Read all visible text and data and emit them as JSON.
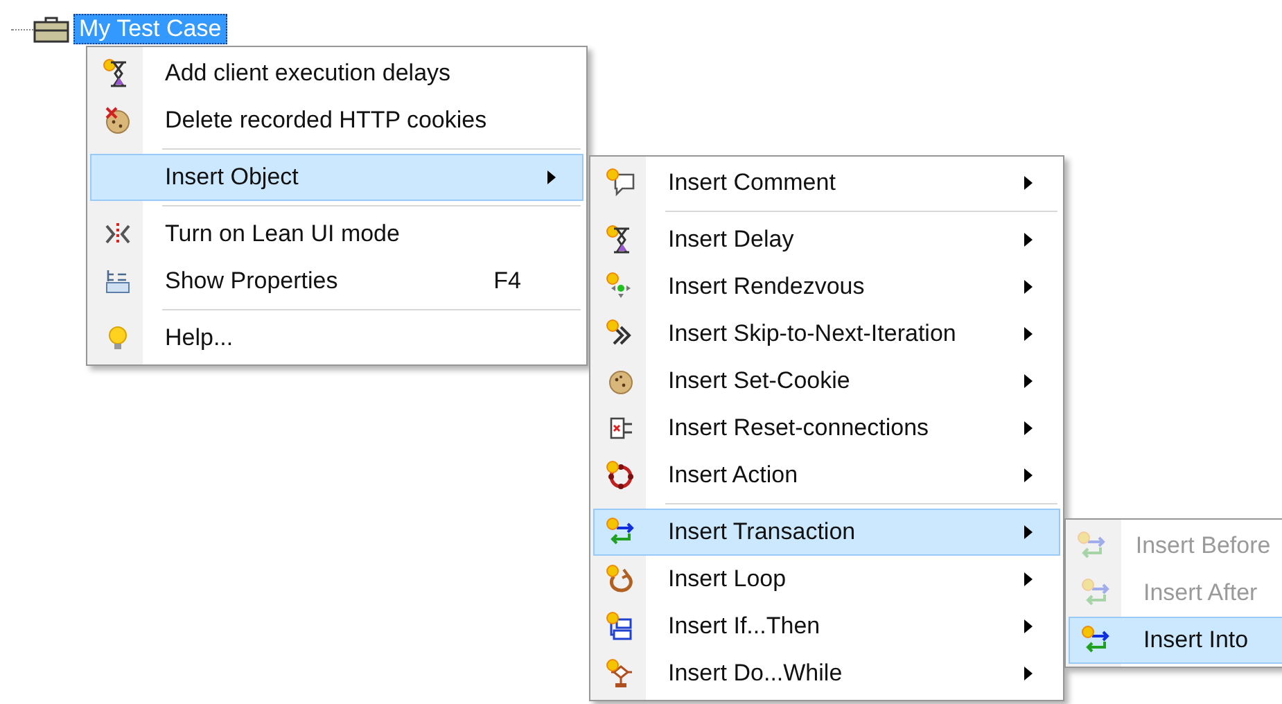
{
  "tree_node": {
    "label": "My Test Case",
    "selected": true
  },
  "context_menu": {
    "items": [
      {
        "kind": "item",
        "label": "Add client execution delays",
        "selected": false
      },
      {
        "kind": "item",
        "label": "Delete recorded HTTP cookies",
        "selected": false
      },
      {
        "kind": "separator"
      },
      {
        "kind": "submenu",
        "label": "Insert Object",
        "selected": true
      },
      {
        "kind": "separator"
      },
      {
        "kind": "item",
        "label": "Turn on Lean UI mode",
        "selected": false
      },
      {
        "kind": "item",
        "label": "Show Properties",
        "shortcut": "F4",
        "selected": false
      },
      {
        "kind": "separator"
      },
      {
        "kind": "item",
        "label": "Help...",
        "selected": false
      }
    ]
  },
  "insert_object_menu": {
    "items": [
      {
        "kind": "submenu",
        "label": "Insert Comment",
        "selected": false
      },
      {
        "kind": "separator"
      },
      {
        "kind": "submenu",
        "label": "Insert Delay",
        "selected": false
      },
      {
        "kind": "submenu",
        "label": "Insert Rendezvous",
        "selected": false
      },
      {
        "kind": "submenu",
        "label": "Insert Skip-to-Next-Iteration",
        "selected": false
      },
      {
        "kind": "submenu",
        "label": "Insert Set-Cookie",
        "selected": false
      },
      {
        "kind": "submenu",
        "label": "Insert Reset-connections",
        "selected": false
      },
      {
        "kind": "submenu",
        "label": "Insert Action",
        "selected": false
      },
      {
        "kind": "separator"
      },
      {
        "kind": "submenu",
        "label": "Insert Transaction",
        "selected": true
      },
      {
        "kind": "submenu",
        "label": "Insert Loop",
        "selected": false
      },
      {
        "kind": "submenu",
        "label": "Insert If...Then",
        "selected": false
      },
      {
        "kind": "submenu",
        "label": "Insert Do...While",
        "selected": false
      }
    ]
  },
  "insert_transaction_menu": {
    "items": [
      {
        "kind": "item",
        "label": "Insert Before",
        "disabled": true,
        "selected": false
      },
      {
        "kind": "item",
        "label": "Insert After",
        "disabled": true,
        "selected": false
      },
      {
        "kind": "item",
        "label": "Insert Into",
        "disabled": false,
        "selected": true
      }
    ]
  }
}
